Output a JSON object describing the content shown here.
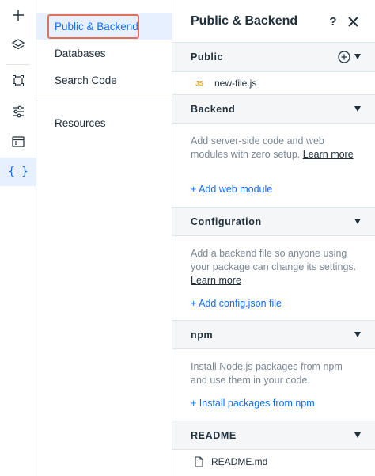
{
  "rail": {
    "buttons": [
      {
        "name": "add-icon"
      },
      {
        "name": "layers-icon"
      },
      {
        "name": "crop-icon"
      },
      {
        "name": "sliders-icon"
      },
      {
        "name": "table-icon"
      },
      {
        "name": "code-braces-icon",
        "glyph": "{ }"
      }
    ]
  },
  "nav": {
    "items": [
      {
        "label": "Public & Backend"
      },
      {
        "label": "Databases"
      },
      {
        "label": "Search Code"
      },
      {
        "label": "Resources"
      }
    ]
  },
  "panel": {
    "title": "Public & Backend",
    "help": "?",
    "sections": {
      "public": {
        "title": "Public",
        "files": [
          {
            "badge": "JS",
            "name": "new-file.js"
          }
        ]
      },
      "backend": {
        "title": "Backend",
        "desc": "Add server-side code and web modules with zero setup.",
        "link": "Learn more",
        "action": "+ Add web module"
      },
      "configuration": {
        "title": "Configuration",
        "desc": "Add a backend file so anyone using your package can change its settings.",
        "link": "Learn more",
        "action": "+ Add config.json file"
      },
      "npm": {
        "title": "npm",
        "desc": "Install Node.js packages from npm and use them in your code.",
        "action": "+ Install packages from npm"
      },
      "readme": {
        "title": "README",
        "files": [
          {
            "name": "README.md"
          }
        ]
      }
    }
  },
  "colors": {
    "accent": "#116dff",
    "highlight_border": "#e4705a",
    "active_bg": "#e7f0ff",
    "section_bg": "#f4f6f8",
    "js_badge": "#f0a43c"
  }
}
